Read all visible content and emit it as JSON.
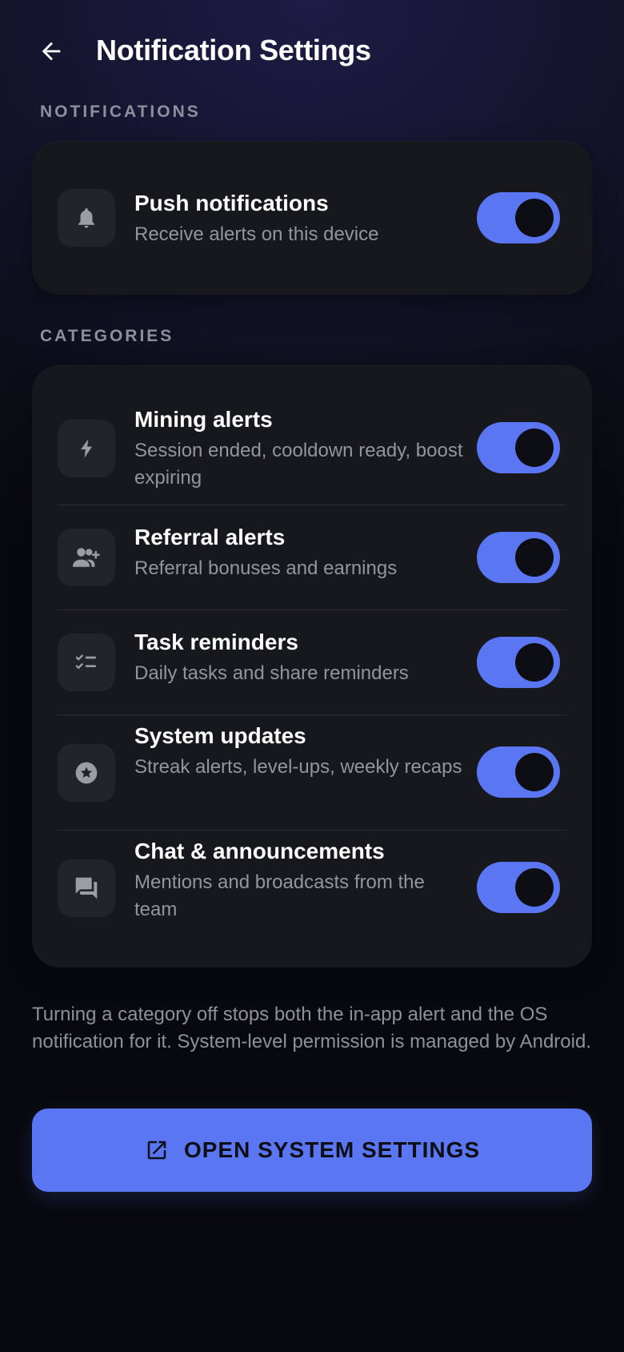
{
  "header": {
    "title": "Notification Settings",
    "back_icon": "arrow-left-icon"
  },
  "notifications_section": {
    "label": "NOTIFICATIONS",
    "push": {
      "icon": "bell-icon",
      "title": "Push notifications",
      "subtitle": "Receive alerts on this device",
      "enabled": true
    }
  },
  "categories_section": {
    "label": "CATEGORIES",
    "items": [
      {
        "icon": "lightning-bolt-icon",
        "title": "Mining alerts",
        "subtitle": "Session ended, cooldown ready, boost expiring",
        "enabled": true
      },
      {
        "icon": "person-add-icon",
        "title": "Referral alerts",
        "subtitle": "Referral bonuses and earnings",
        "enabled": true
      },
      {
        "icon": "checklist-icon",
        "title": "Task reminders",
        "subtitle": "Daily tasks and share reminders",
        "enabled": true
      },
      {
        "icon": "star-badge-icon",
        "title": "System updates",
        "subtitle": "Streak alerts, level-ups, weekly recaps",
        "enabled": true
      },
      {
        "icon": "chat-bubbles-icon",
        "title": "Chat & announcements",
        "subtitle": "Mentions and broadcasts from the team",
        "enabled": true
      }
    ]
  },
  "footnote": "Turning a category off stops both the in-app alert and the OS notification for it. System-level permission is managed by Android.",
  "open_settings_button": {
    "label": "OPEN SYSTEM SETTINGS",
    "icon": "open-external-icon"
  },
  "colors": {
    "accent": "#5b76f2",
    "card": "#17181d",
    "icon_bg": "#22242b",
    "muted_text": "#92949f"
  }
}
